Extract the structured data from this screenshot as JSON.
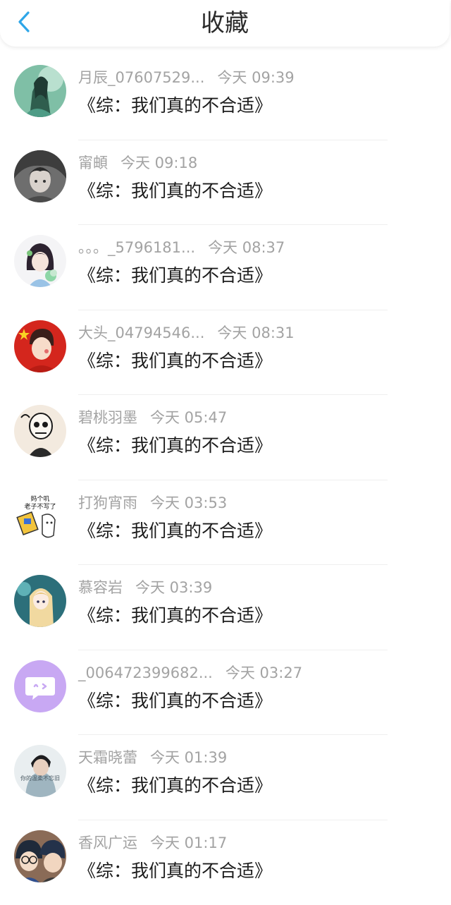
{
  "header": {
    "title": "收藏",
    "accent": "#2ea6e8"
  },
  "items": [
    {
      "name": "月辰_07607529...",
      "time": "今天 09:39",
      "title": "《综：我们真的不合适》",
      "avatar_icon": "anime-girl-green-avatar"
    },
    {
      "name": "甯頔",
      "time": "今天 09:18",
      "title": "《综：我们真的不合适》",
      "avatar_icon": "anime-boy-gray-avatar"
    },
    {
      "name": "。。。_5796181...",
      "time": "今天 08:37",
      "title": "《综：我们真的不合适》",
      "avatar_icon": "anime-girl-flowers-avatar"
    },
    {
      "name": "大头_04794546...",
      "time": "今天 08:31",
      "title": "《综：我们真的不合适》",
      "avatar_icon": "flag-boy-avatar"
    },
    {
      "name": "碧桃羽墨",
      "time": "今天 05:47",
      "title": "《综：我们真的不合适》",
      "avatar_icon": "skull-sketch-avatar"
    },
    {
      "name": "打狗宵雨",
      "time": "今天 03:53",
      "title": "《综：我们真的不合适》",
      "avatar_icon": "meme-sticker-avatar",
      "avatar_text": "妈个叽\n老子不写了"
    },
    {
      "name": "慕容岩",
      "time": "今天 03:39",
      "title": "《综：我们真的不合适》",
      "avatar_icon": "anime-blonde-girl-avatar"
    },
    {
      "name": "_006472399682...",
      "time": "今天 03:27",
      "title": "《综：我们真的不合适》",
      "avatar_icon": "default-chat-bubble-avatar"
    },
    {
      "name": "天霜晓蕾",
      "time": "今天 01:39",
      "title": "《综：我们真的不合适》",
      "avatar_icon": "photo-boy-avatar",
      "avatar_text": "你的温柔不忘旧"
    },
    {
      "name": "香风广运",
      "time": "今天 01:17",
      "title": "《综：我们真的不合适》",
      "avatar_icon": "detective-conan-avatar"
    }
  ]
}
